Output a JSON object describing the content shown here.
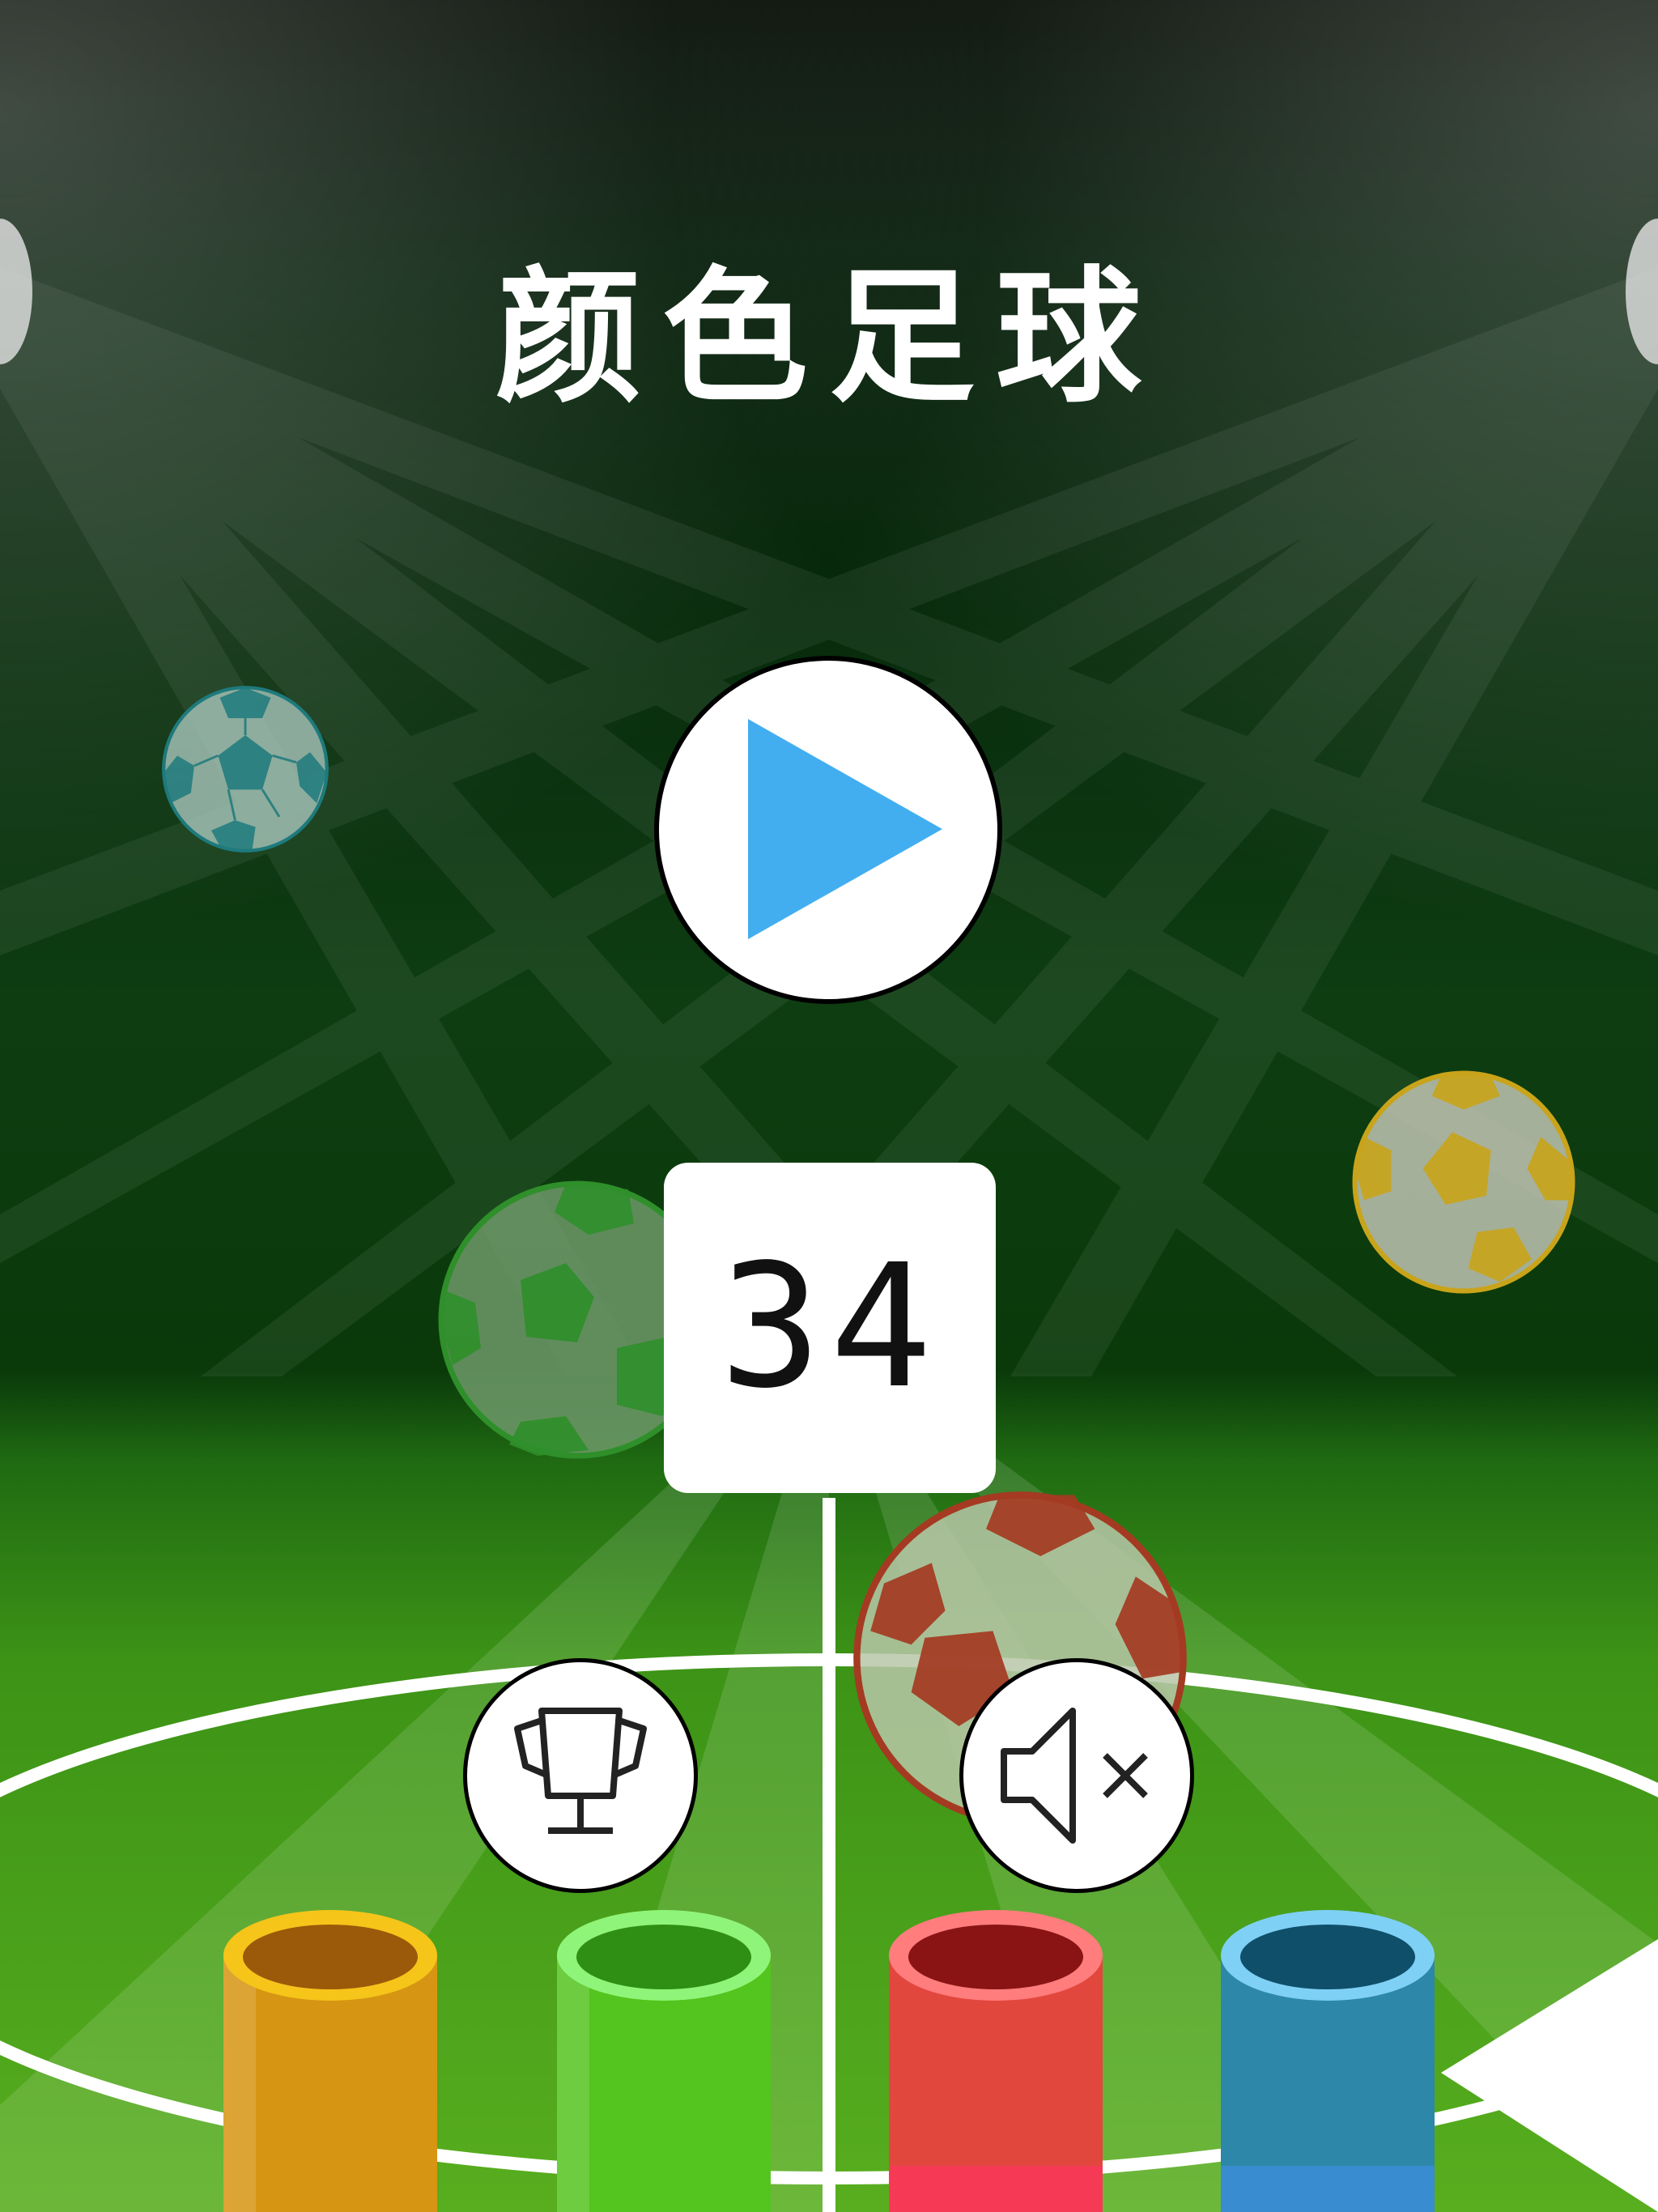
{
  "game": {
    "title": "颜色足球",
    "score": "34"
  },
  "controls": {
    "play_icon": "play-triangle",
    "leaderboard_icon": "trophy-icon",
    "sound_icon": "speaker-muted-icon"
  },
  "balls": [
    {
      "color": "teal",
      "main": "#1e7a7c"
    },
    {
      "color": "yellow",
      "main": "#c9a41a"
    },
    {
      "color": "green",
      "main": "#2f8f2a"
    },
    {
      "color": "red",
      "main": "#a43a22"
    }
  ],
  "tubes": [
    {
      "color": "orange",
      "rim": "#f5c51a",
      "body": "#d69512"
    },
    {
      "color": "green",
      "rim": "#8ff57a",
      "body": "#54c41e"
    },
    {
      "color": "red",
      "rim": "#ff7d7d",
      "body": "#e2473e"
    },
    {
      "color": "blue",
      "rim": "#7fd0f5",
      "body": "#2d87a8"
    }
  ],
  "colors": {
    "play_triangle": "#42aef0",
    "field_green": "#4ea51a",
    "sky_dark": "#021a06"
  }
}
